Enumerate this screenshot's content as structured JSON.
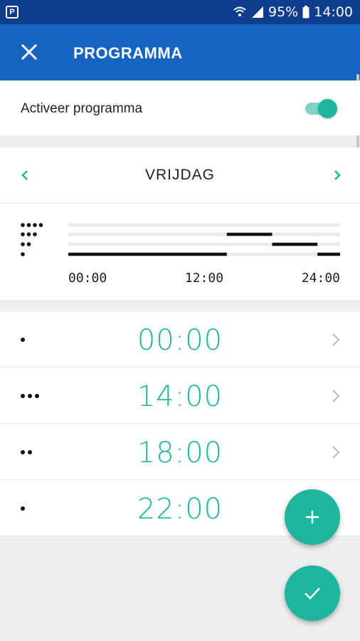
{
  "status_bar": {
    "battery": "95%",
    "time": "14:00"
  },
  "app_bar": {
    "title": "PROGRAMMA",
    "close_icon": "close-icon"
  },
  "activate": {
    "label": "Activeer programma",
    "enabled": true
  },
  "day_selector": {
    "day": "VRIJDAG"
  },
  "schedule_graph": {
    "x_ticks": [
      "00:00",
      "12:00",
      "24:00"
    ],
    "levels": [
      4,
      3,
      2,
      1
    ],
    "segments": [
      {
        "start_hour": 0,
        "end_hour": 14,
        "level": 1
      },
      {
        "start_hour": 14,
        "end_hour": 18,
        "level": 3
      },
      {
        "start_hour": 18,
        "end_hour": 22,
        "level": 2
      },
      {
        "start_hour": 22,
        "end_hour": 24,
        "level": 1
      }
    ]
  },
  "slots": [
    {
      "time": "00:00",
      "level": 1,
      "chevron": true
    },
    {
      "time": "14:00",
      "level": 3,
      "chevron": true
    },
    {
      "time": "18:00",
      "level": 2,
      "chevron": true
    },
    {
      "time": "22:00",
      "level": 1,
      "chevron": false
    }
  ],
  "fabs": {
    "add_icon": "plus-icon",
    "confirm_icon": "check-icon"
  },
  "colors": {
    "accent": "#1fb59c",
    "app_bar": "#1565c0",
    "status_bar": "#0d3d8c"
  }
}
